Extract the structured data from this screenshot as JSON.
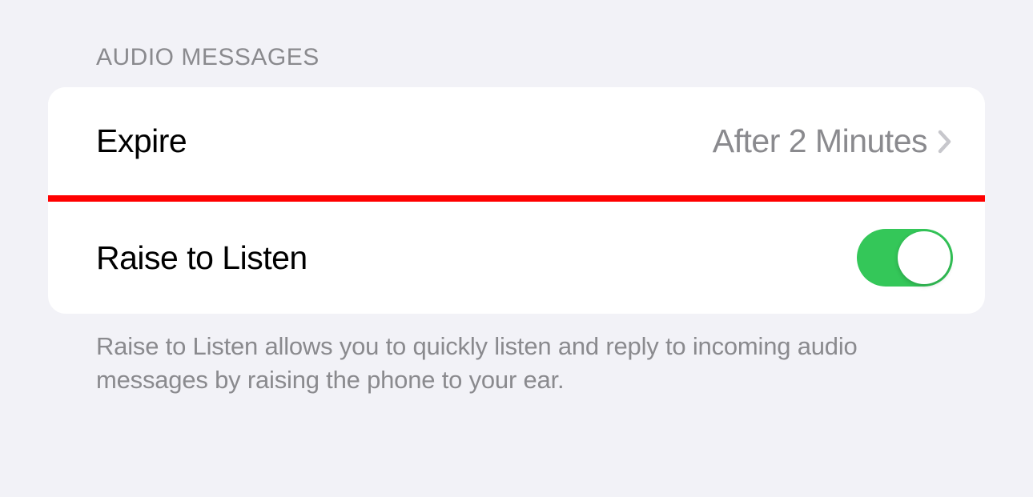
{
  "section": {
    "header": "AUDIO MESSAGES",
    "footer": "Raise to Listen allows you to quickly listen and reply to incoming audio messages by raising the phone to your ear."
  },
  "rows": {
    "expire": {
      "label": "Expire",
      "value": "After 2 Minutes"
    },
    "raiseToListen": {
      "label": "Raise to Listen",
      "enabled": true
    }
  },
  "colors": {
    "toggleOn": "#34c759",
    "highlight": "#ff0000"
  }
}
